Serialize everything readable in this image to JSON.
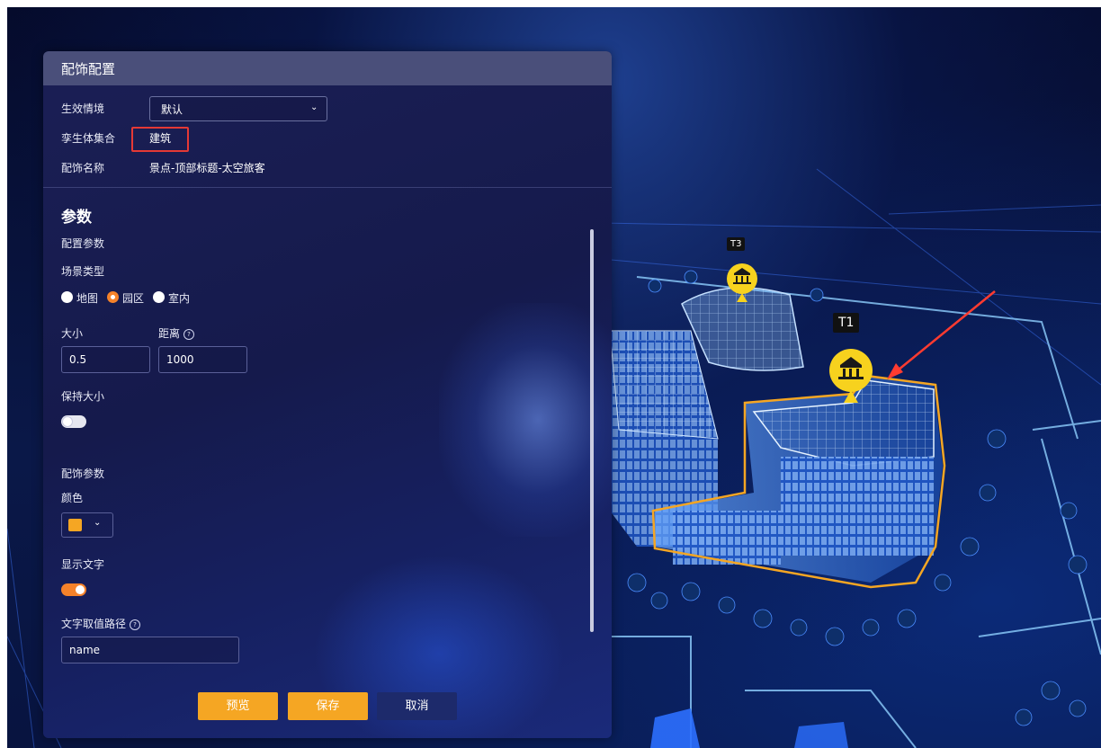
{
  "panel": {
    "title": "配饰配置",
    "effect_label": "生效情境",
    "effect_value": "默认",
    "twin_label": "孪生体集合",
    "twin_value": "建筑",
    "accessory_name_label": "配饰名称",
    "accessory_name_value": "景点-顶部标题-太空旅客",
    "params_section": "参数",
    "config_params_label": "配置参数",
    "scene_type_label": "场景类型",
    "scene_options": [
      {
        "label": "地图",
        "selected": false
      },
      {
        "label": "园区",
        "selected": true
      },
      {
        "label": "室内",
        "selected": false
      }
    ],
    "size_label": "大小",
    "distance_label": "距离",
    "size_value": "0.5",
    "distance_value": "1000",
    "keep_size_label": "保持大小",
    "keep_size_on": false,
    "accessory_params_label": "配饰参数",
    "color_label": "颜色",
    "color_value": "#f5a623",
    "show_text_label": "显示文字",
    "show_text_on": true,
    "text_path_label": "文字取值路径",
    "text_path_value": "name"
  },
  "buttons": {
    "preview": "预览",
    "save": "保存",
    "cancel": "取消"
  },
  "scene": {
    "tag_t3": "T3",
    "tag_t1": "T1",
    "marker_icon": "museum-icon"
  },
  "colors": {
    "accent": "#f5a623",
    "toggle_on": "#f5822a",
    "cancel_bg": "#1d2a6b",
    "highlight_outline": "#e53935"
  }
}
